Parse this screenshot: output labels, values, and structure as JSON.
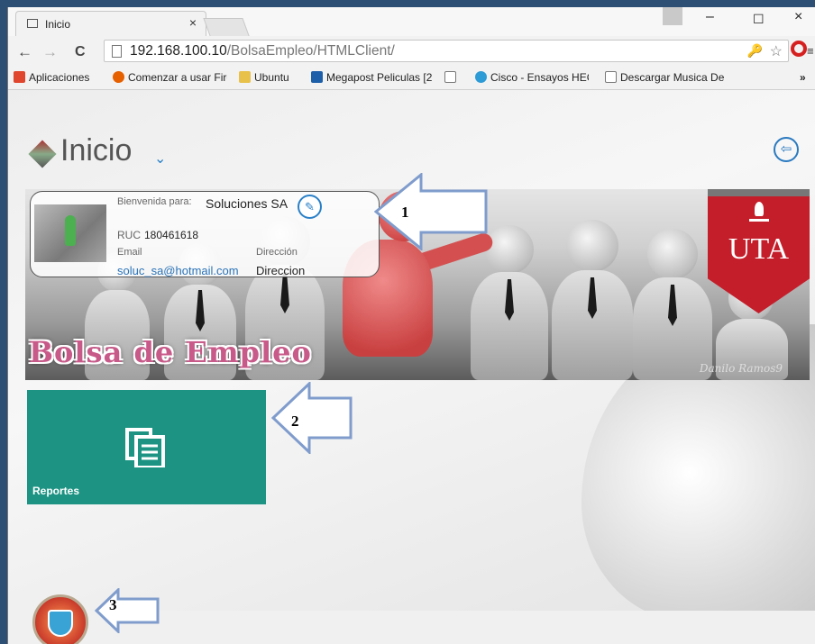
{
  "browser": {
    "tab_title": "Inicio",
    "tab_close": "×",
    "window_controls": {
      "minimize": "–",
      "maximize": "☐",
      "close": "×"
    },
    "nav": {
      "back": "←",
      "forward": "→",
      "reload": "C"
    },
    "url_host": "192.168.100.10",
    "url_path": "/BolsaEmpleo/HTMLClient/",
    "key_icon": "🔑",
    "star_icon": "☆",
    "menu_icon": "≡",
    "bookmarks": [
      {
        "label": "Aplicaciones",
        "icon": "apps-icon",
        "color": "#e0462d"
      },
      {
        "label": "Comenzar a usar Firef",
        "icon": "firefox-icon",
        "color": "#e66000"
      },
      {
        "label": "Ubuntu",
        "icon": "folder-icon",
        "color": "#e8c14a"
      },
      {
        "label": "Megapost Peliculas [2",
        "icon": "taringa-icon",
        "color": "#1d5fa8"
      },
      {
        "label": "",
        "icon": "page-icon",
        "color": "#ffffff"
      },
      {
        "label": "Cisco - Ensayos HECH",
        "icon": "cisco-icon",
        "color": "#2d9bd6"
      },
      {
        "label": "Descargar Musica De",
        "icon": "page-icon",
        "color": "#ffffff"
      }
    ],
    "bookmarks_overflow": "»"
  },
  "page": {
    "title": "Inicio",
    "title_chevron": "⌄",
    "logout_icon": "⇦"
  },
  "welcome": {
    "greeting_label": "Bienvenida para:",
    "company": "Soluciones SA",
    "ruc_label": "RUC",
    "ruc_value": "180461618",
    "email_label": "Email",
    "email_value": "soluc_sa@hotmail.com",
    "address_label": "Dirección",
    "address_value": "Direccion",
    "edit_icon": "✎"
  },
  "banner": {
    "title": "Bolsa de Empleo",
    "logo_text": "UTA",
    "signature": "Danilo Ramos9"
  },
  "tile": {
    "label": "Reportes"
  },
  "annotations": [
    "1",
    "2",
    "3"
  ],
  "colors": {
    "accent": "#2a80c8",
    "tile": "#1c9383",
    "uta_red": "#c41e2a",
    "arrow_fill": "#ffffff",
    "arrow_stroke": "#7f9ccc"
  }
}
